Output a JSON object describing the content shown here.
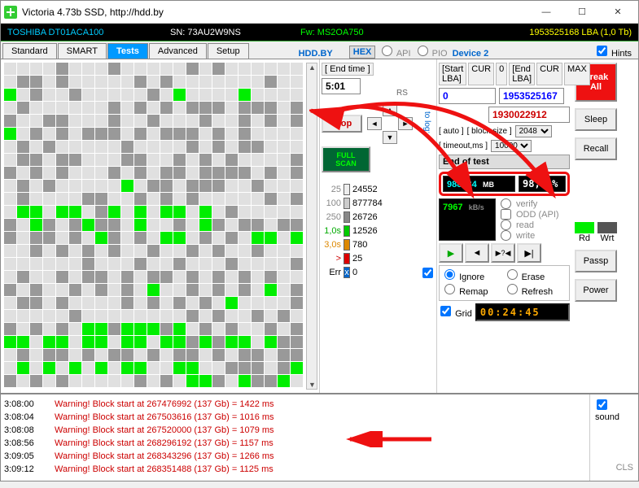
{
  "window": {
    "title": "Victoria 4.73b SSD, http://hdd.by"
  },
  "drive": {
    "model": "TOSHIBA DT01ACA100",
    "sn": "SN: 73AU2W9NS",
    "fw": "Fw: MS2OA750",
    "lba": "1953525168 LBA (1,0 Tb)"
  },
  "tabs": {
    "t0": "Standard",
    "t1": "SMART",
    "t2": "Tests",
    "t3": "Advanced",
    "t4": "Setup",
    "link": "HDD.BY",
    "hex": "HEX",
    "api": "API",
    "pio": "PIO",
    "device": "Device 2",
    "hints": "Hints"
  },
  "mid": {
    "endtime_lbl": "[ End time ]",
    "startlba_lbl": "[Start LBA]",
    "cur": "CUR",
    "zero": "0",
    "endlba_lbl": "[End LBA]",
    "max": "MAX",
    "endtime": "5:01",
    "startlba": "0",
    "endlba": "1953525167",
    "position": "1930022912",
    "stop": "Stop",
    "fullscan": "FULL SCAN",
    "auto": "[ auto ]",
    "blocksize": "[ block size ]",
    "bs_val": "2048",
    "timeout": "[ timeout,ms ]",
    "to_val": "10000",
    "endoftest": "End of test",
    "rs": "RS",
    "to_log": "to log:",
    "s0_l": "25",
    "s0_v": "24552",
    "s1_l": "100",
    "s1_v": "877784",
    "s2_l": "250",
    "s2_v": "26726",
    "s3_l": "1,0s",
    "s3_v": "12526",
    "s4_l": "3,0s",
    "s4_v": "780",
    "s5_l": ">",
    "s5_v": "25",
    "s6_l": "Err",
    "s6_v": "0"
  },
  "right": {
    "mb_val": "988234",
    "mb_u": "MB",
    "pct": "98,8  %",
    "kbs_val": "7967",
    "kbs_u": "kB/s",
    "verify": "verify",
    "odd": "ODD (API)",
    "read": "read",
    "write": "write",
    "ignore": "Ignore",
    "erase": "Erase",
    "remap": "Remap",
    "refresh": "Refresh",
    "grid": "Grid",
    "timer": "00:24:45"
  },
  "side": {
    "break": "Break All",
    "sleep": "Sleep",
    "recall": "Recall",
    "rd": "Rd",
    "wrt": "Wrt",
    "passp": "Passp",
    "power": "Power",
    "sound": "sound",
    "cls": "CLS"
  },
  "log": [
    {
      "ts": "3:08:00",
      "msg": "Warning! Block start at 267476992 (137 Gb)  = 1422 ms"
    },
    {
      "ts": "3:08:04",
      "msg": "Warning! Block start at 267503616 (137 Gb)  = 1016 ms"
    },
    {
      "ts": "3:08:08",
      "msg": "Warning! Block start at 267520000 (137 Gb)  = 1079 ms"
    },
    {
      "ts": "3:08:56",
      "msg": "Warning! Block start at 268296192 (137 Gb)  = 1157 ms"
    },
    {
      "ts": "3:09:05",
      "msg": "Warning! Block start at 268343296 (137 Gb)  = 1266 ms"
    },
    {
      "ts": "3:09:12",
      "msg": "Warning! Block start at 268351488 (137 Gb)  = 1125 ms"
    }
  ],
  "grid_pattern": "....d...d.....d.d......|.dd.d.....d.d.......d..|g.d..d.....d.g....g....|.d......d.d.d.ddd.ddd.d|d..dd...d..d...d..d.d.d|g.d.d.ddd.d.ddd.d.d....|.d.d.....d....d.d.dd...|.dd.dd...dd..d.d.d....d|d.d.d...d.d.dd.dddd.d.d|.d.d.....g.dd.ddd..d...|.d....dd..d.d.d.....d.d|.gg.gg.dg.g.gg.g.d.....|d.gd.dgdd.g..d.gd.dd.dd|d.dd.d.gd.d.gg.d.d.gg.g|..d.d.d.d..d..d.d..d...|......d...d..d...d....d|.d..d.dd.d.dd.d.d.d.d..|d.d..d.d.d.g..d.d.d.g.d|.dd.d....d.d.d.d.g....d|.....d........d.d..d.d.|d.d.d.ggdgggdg.d.d..d.d|gg.gg.gg.gg.ggdgdgg.gdd|.d.dd.d.dd.d.dd.d.dd.dd|.g.g.g.g.gg..gg..ddd.dg|d.d.d.....d.d.ggd.gddg."
}
